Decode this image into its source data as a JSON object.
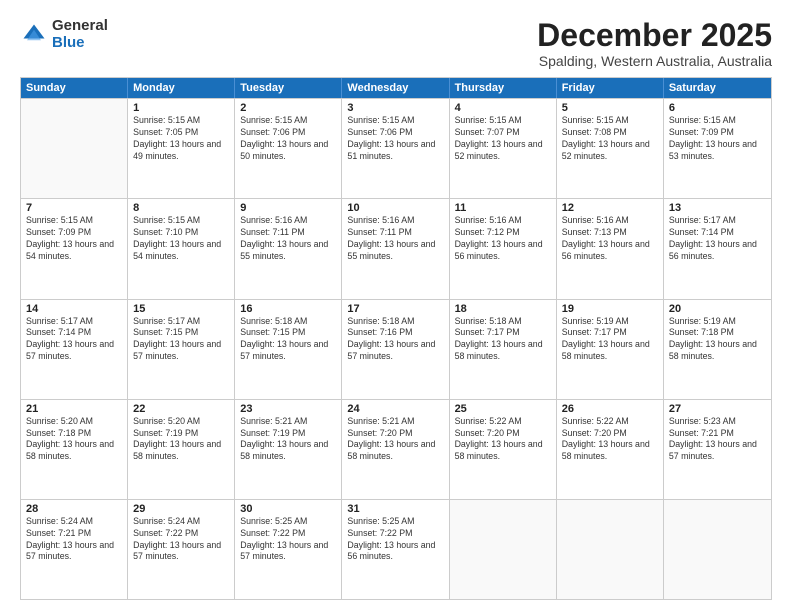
{
  "logo": {
    "general": "General",
    "blue": "Blue"
  },
  "header": {
    "month": "December 2025",
    "location": "Spalding, Western Australia, Australia"
  },
  "weekdays": [
    "Sunday",
    "Monday",
    "Tuesday",
    "Wednesday",
    "Thursday",
    "Friday",
    "Saturday"
  ],
  "weeks": [
    [
      {
        "day": "",
        "sunrise": "",
        "sunset": "",
        "daylight": ""
      },
      {
        "day": "1",
        "sunrise": "Sunrise: 5:15 AM",
        "sunset": "Sunset: 7:05 PM",
        "daylight": "Daylight: 13 hours and 49 minutes."
      },
      {
        "day": "2",
        "sunrise": "Sunrise: 5:15 AM",
        "sunset": "Sunset: 7:06 PM",
        "daylight": "Daylight: 13 hours and 50 minutes."
      },
      {
        "day": "3",
        "sunrise": "Sunrise: 5:15 AM",
        "sunset": "Sunset: 7:06 PM",
        "daylight": "Daylight: 13 hours and 51 minutes."
      },
      {
        "day": "4",
        "sunrise": "Sunrise: 5:15 AM",
        "sunset": "Sunset: 7:07 PM",
        "daylight": "Daylight: 13 hours and 52 minutes."
      },
      {
        "day": "5",
        "sunrise": "Sunrise: 5:15 AM",
        "sunset": "Sunset: 7:08 PM",
        "daylight": "Daylight: 13 hours and 52 minutes."
      },
      {
        "day": "6",
        "sunrise": "Sunrise: 5:15 AM",
        "sunset": "Sunset: 7:09 PM",
        "daylight": "Daylight: 13 hours and 53 minutes."
      }
    ],
    [
      {
        "day": "7",
        "sunrise": "Sunrise: 5:15 AM",
        "sunset": "Sunset: 7:09 PM",
        "daylight": "Daylight: 13 hours and 54 minutes."
      },
      {
        "day": "8",
        "sunrise": "Sunrise: 5:15 AM",
        "sunset": "Sunset: 7:10 PM",
        "daylight": "Daylight: 13 hours and 54 minutes."
      },
      {
        "day": "9",
        "sunrise": "Sunrise: 5:16 AM",
        "sunset": "Sunset: 7:11 PM",
        "daylight": "Daylight: 13 hours and 55 minutes."
      },
      {
        "day": "10",
        "sunrise": "Sunrise: 5:16 AM",
        "sunset": "Sunset: 7:11 PM",
        "daylight": "Daylight: 13 hours and 55 minutes."
      },
      {
        "day": "11",
        "sunrise": "Sunrise: 5:16 AM",
        "sunset": "Sunset: 7:12 PM",
        "daylight": "Daylight: 13 hours and 56 minutes."
      },
      {
        "day": "12",
        "sunrise": "Sunrise: 5:16 AM",
        "sunset": "Sunset: 7:13 PM",
        "daylight": "Daylight: 13 hours and 56 minutes."
      },
      {
        "day": "13",
        "sunrise": "Sunrise: 5:17 AM",
        "sunset": "Sunset: 7:14 PM",
        "daylight": "Daylight: 13 hours and 56 minutes."
      }
    ],
    [
      {
        "day": "14",
        "sunrise": "Sunrise: 5:17 AM",
        "sunset": "Sunset: 7:14 PM",
        "daylight": "Daylight: 13 hours and 57 minutes."
      },
      {
        "day": "15",
        "sunrise": "Sunrise: 5:17 AM",
        "sunset": "Sunset: 7:15 PM",
        "daylight": "Daylight: 13 hours and 57 minutes."
      },
      {
        "day": "16",
        "sunrise": "Sunrise: 5:18 AM",
        "sunset": "Sunset: 7:15 PM",
        "daylight": "Daylight: 13 hours and 57 minutes."
      },
      {
        "day": "17",
        "sunrise": "Sunrise: 5:18 AM",
        "sunset": "Sunset: 7:16 PM",
        "daylight": "Daylight: 13 hours and 57 minutes."
      },
      {
        "day": "18",
        "sunrise": "Sunrise: 5:18 AM",
        "sunset": "Sunset: 7:17 PM",
        "daylight": "Daylight: 13 hours and 58 minutes."
      },
      {
        "day": "19",
        "sunrise": "Sunrise: 5:19 AM",
        "sunset": "Sunset: 7:17 PM",
        "daylight": "Daylight: 13 hours and 58 minutes."
      },
      {
        "day": "20",
        "sunrise": "Sunrise: 5:19 AM",
        "sunset": "Sunset: 7:18 PM",
        "daylight": "Daylight: 13 hours and 58 minutes."
      }
    ],
    [
      {
        "day": "21",
        "sunrise": "Sunrise: 5:20 AM",
        "sunset": "Sunset: 7:18 PM",
        "daylight": "Daylight: 13 hours and 58 minutes."
      },
      {
        "day": "22",
        "sunrise": "Sunrise: 5:20 AM",
        "sunset": "Sunset: 7:19 PM",
        "daylight": "Daylight: 13 hours and 58 minutes."
      },
      {
        "day": "23",
        "sunrise": "Sunrise: 5:21 AM",
        "sunset": "Sunset: 7:19 PM",
        "daylight": "Daylight: 13 hours and 58 minutes."
      },
      {
        "day": "24",
        "sunrise": "Sunrise: 5:21 AM",
        "sunset": "Sunset: 7:20 PM",
        "daylight": "Daylight: 13 hours and 58 minutes."
      },
      {
        "day": "25",
        "sunrise": "Sunrise: 5:22 AM",
        "sunset": "Sunset: 7:20 PM",
        "daylight": "Daylight: 13 hours and 58 minutes."
      },
      {
        "day": "26",
        "sunrise": "Sunrise: 5:22 AM",
        "sunset": "Sunset: 7:20 PM",
        "daylight": "Daylight: 13 hours and 58 minutes."
      },
      {
        "day": "27",
        "sunrise": "Sunrise: 5:23 AM",
        "sunset": "Sunset: 7:21 PM",
        "daylight": "Daylight: 13 hours and 57 minutes."
      }
    ],
    [
      {
        "day": "28",
        "sunrise": "Sunrise: 5:24 AM",
        "sunset": "Sunset: 7:21 PM",
        "daylight": "Daylight: 13 hours and 57 minutes."
      },
      {
        "day": "29",
        "sunrise": "Sunrise: 5:24 AM",
        "sunset": "Sunset: 7:22 PM",
        "daylight": "Daylight: 13 hours and 57 minutes."
      },
      {
        "day": "30",
        "sunrise": "Sunrise: 5:25 AM",
        "sunset": "Sunset: 7:22 PM",
        "daylight": "Daylight: 13 hours and 57 minutes."
      },
      {
        "day": "31",
        "sunrise": "Sunrise: 5:25 AM",
        "sunset": "Sunset: 7:22 PM",
        "daylight": "Daylight: 13 hours and 56 minutes."
      },
      {
        "day": "",
        "sunrise": "",
        "sunset": "",
        "daylight": ""
      },
      {
        "day": "",
        "sunrise": "",
        "sunset": "",
        "daylight": ""
      },
      {
        "day": "",
        "sunrise": "",
        "sunset": "",
        "daylight": ""
      }
    ]
  ]
}
